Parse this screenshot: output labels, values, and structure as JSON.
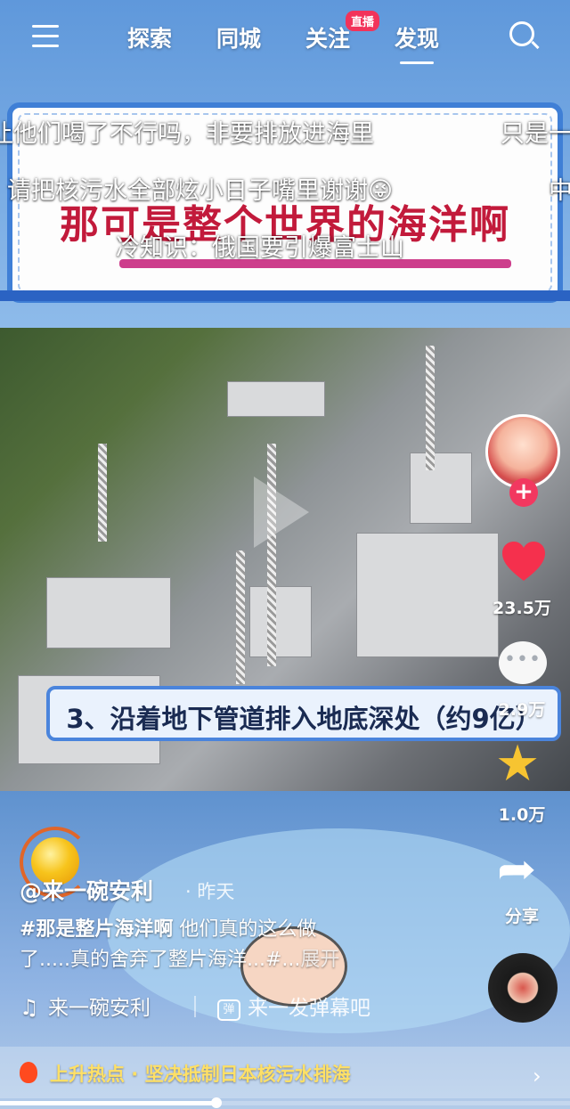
{
  "nav": {
    "tabs": [
      "探索",
      "同城",
      "关注",
      "发现"
    ],
    "live_badge": "直播",
    "active_tab": "发现"
  },
  "banner": {
    "title": "那可是整个世界的海洋啊"
  },
  "danmaku": [
    "让他们喝了不行吗，非要排放进海里",
    "只是一",
    "请把核污水全部炫小日子嘴里谢谢😜",
    "中",
    "冷知识：俄国要引爆富士山"
  ],
  "video": {
    "subtitle": "3、沿着地下管道排入地底深处（约9亿）"
  },
  "rail": {
    "likes": "23.5万",
    "comments": "2.9万",
    "favorites": "1.0万",
    "share_label": "分享",
    "follow_symbol": "+"
  },
  "post": {
    "author": "@来一碗安利",
    "posted": "· 昨天",
    "hashtag": "#那是整片海洋啊",
    "desc_line1_rest": " 他们真的这么做",
    "desc_line2": "了.....真的舍弃了整片海洋...#...",
    "expand": "展开",
    "music": "来一碗安利",
    "danmu_placeholder": "来一发弹幕吧",
    "danmu_icon": "弹"
  },
  "hot": {
    "text": "上升热点 · 坚决抵制日本核污水排海"
  },
  "playback": {
    "progress": 0.38
  },
  "colors": {
    "accent": "#f2335a",
    "hot_text": "#ffe066",
    "star": "#f7c431"
  }
}
